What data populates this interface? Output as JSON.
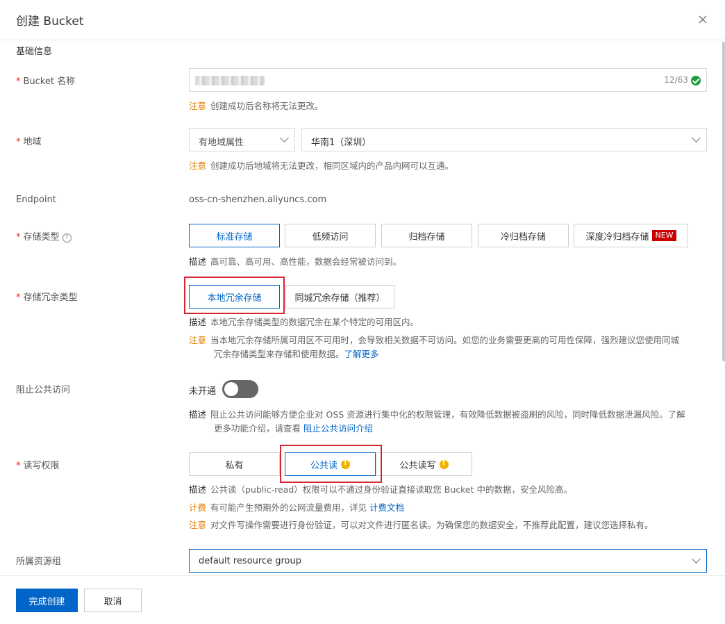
{
  "dialog": {
    "title": "创建 Bucket"
  },
  "section": {
    "basic_info": "基础信息"
  },
  "bucket_name": {
    "label": "Bucket 名称",
    "counter": "12/63",
    "hint_key": "注意",
    "hint_text": "创建成功后名称将无法更改。"
  },
  "region": {
    "label": "地域",
    "attr_select": "有地域属性",
    "region_select": "华南1（深圳）",
    "hint_key": "注意",
    "hint_text": "创建成功后地域将无法更改，相同区域内的产品内网可以互通。"
  },
  "endpoint": {
    "label": "Endpoint",
    "value": "oss-cn-shenzhen.aliyuncs.com"
  },
  "storage_class": {
    "label": "存储类型",
    "help_icon": "question-circle-icon",
    "options": [
      "标准存储",
      "低频访问",
      "归档存储",
      "冷归档存储",
      "深度冷归档存储"
    ],
    "new_badge": "NEW",
    "selected": "标准存储",
    "desc_key": "描述",
    "desc_text": "高可靠、高可用、高性能，数据会经常被访问到。"
  },
  "redundancy": {
    "label": "存储冗余类型",
    "options": [
      "本地冗余存储",
      "同城冗余存储（推荐）"
    ],
    "selected": "本地冗余存储",
    "desc_key": "描述",
    "desc_text": "本地冗余存储类型的数据冗余在某个特定的可用区内。",
    "warn_key": "注意",
    "warn_line1": "当本地冗余存储所属可用区不可用时，会导致相关数据不可访问。如您的业务需要更高的可用性保障，强烈建议您使用同城",
    "warn_line2": "冗余存储类型来存储和使用数据。",
    "warn_link": "了解更多"
  },
  "block_public": {
    "label": "阻止公共访问",
    "status": "未开通",
    "enabled": false,
    "desc_key": "描述",
    "desc_line1": "阻止公共访问能够方便企业对 OSS 资源进行集中化的权限管理，有效降低数据被盗刷的风险，同时降低数据泄漏风险。了解",
    "desc_line2": "更多功能介绍，请查看",
    "desc_link": "阻止公共访问介绍"
  },
  "acl": {
    "label": "读写权限",
    "options": [
      "私有",
      "公共读",
      "公共读写"
    ],
    "selected": "公共读",
    "desc_key": "描述",
    "desc_text": "公共读（public-read）权限可以不通过身份验证直接读取您 Bucket 中的数据，安全风险高。",
    "fee_key": "计费",
    "fee_text": "有可能产生预期外的公网流量费用，详见",
    "fee_link": "计费文档",
    "warn_key": "注意",
    "warn_text": "对文件写操作需要进行身份验证，可以对文件进行匿名读。为确保您的数据安全，不推荐此配置，建议您选择私有。"
  },
  "resource_group": {
    "label": "所属资源组",
    "value": "default resource group"
  },
  "footer": {
    "confirm": "完成创建",
    "cancel": "取消"
  },
  "required_mark": "*",
  "colors": {
    "primary": "#0064c8",
    "warning": "#e07b00",
    "highlight": "#d9232d",
    "new_badge": "#c80000"
  }
}
